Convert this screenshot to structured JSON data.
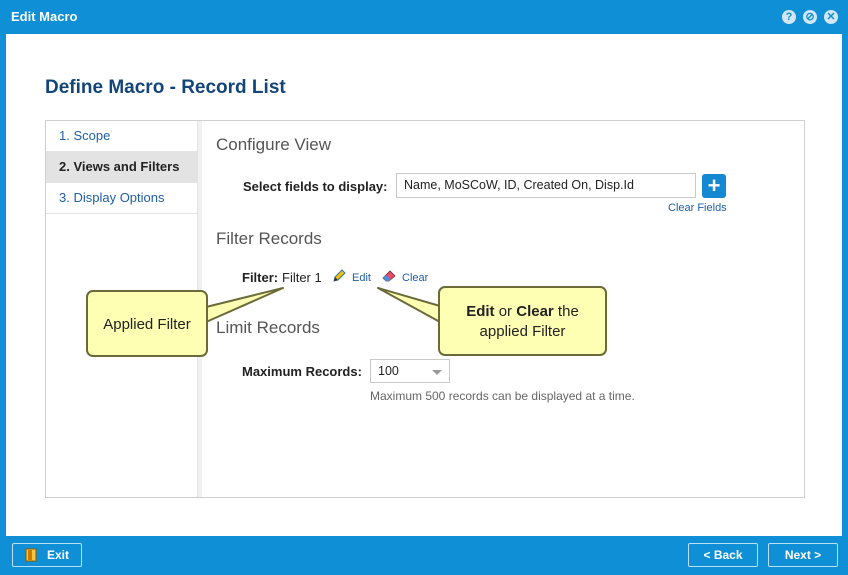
{
  "window": {
    "title": "Edit Macro",
    "help_glyph": "?",
    "minimize_glyph": "⊘",
    "close_glyph": "✕"
  },
  "page": {
    "title": "Define Macro - Record List"
  },
  "steps": [
    {
      "label": "1. Scope",
      "active": false
    },
    {
      "label": "2. Views and Filters",
      "active": true
    },
    {
      "label": "3. Display Options",
      "active": false
    }
  ],
  "configure_view": {
    "heading": "Configure View",
    "fields_label": "Select fields to display:",
    "fields_value": "Name, MoSCoW, ID, Created On, Disp.Id",
    "add_button_glyph": "+",
    "clear_fields_label": "Clear Fields"
  },
  "filter_records": {
    "heading": "Filter Records",
    "filter_label": "Filter:",
    "filter_value": "Filter 1",
    "edit_label": "Edit",
    "clear_label": "Clear"
  },
  "limit_records": {
    "heading": "Limit Records",
    "max_label": "Maximum Records:",
    "max_value": "100",
    "hint": "Maximum 500 records can be displayed at a time."
  },
  "callouts": {
    "applied_filter": "Applied Filter",
    "edit_bold": "Edit",
    "or": " or ",
    "clear_bold": "Clear",
    "the": " the",
    "applied_filter_line2": "applied Filter"
  },
  "footer": {
    "exit_label": "Exit",
    "back_label": "< Back",
    "next_label": "Next >"
  },
  "colors": {
    "accent": "#0f8fd6",
    "title_blue": "#14457a",
    "link_blue": "#1f5fa8",
    "callout_fill": "#ffffb3"
  },
  "icons": {
    "exit": "exit-door-icon",
    "edit": "pencil-icon",
    "clear": "eraser-icon",
    "add": "plus-icon",
    "dropdown": "chevron-down-icon"
  }
}
